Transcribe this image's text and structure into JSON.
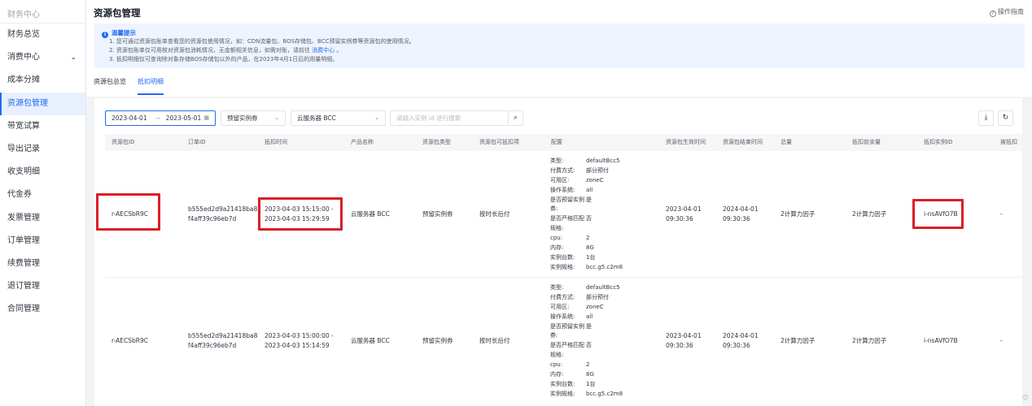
{
  "sidebar": {
    "top_label": "财务中心",
    "items": [
      {
        "label": "财务总览"
      },
      {
        "label": "消费中心",
        "expand": true
      },
      {
        "label": "成本分摊"
      },
      {
        "label": "资源包管理",
        "active": true
      },
      {
        "label": "带宽试算"
      },
      {
        "label": "导出记录"
      },
      {
        "label": "收支明细"
      },
      {
        "label": "代金券"
      },
      {
        "label": "发票管理"
      },
      {
        "label": "订单管理"
      },
      {
        "label": "续费管理"
      },
      {
        "label": "退订管理"
      },
      {
        "label": "合同管理"
      }
    ]
  },
  "header": {
    "title": "资源包管理",
    "guide_label": "操作指南"
  },
  "notice": {
    "title": "温馨提示",
    "lines": [
      "1. 您可通过资源包账单查看您的资源包使用情况，如：CDN流量包、BOS存储包、BCC预留实例券等资源包的使用情况。",
      "2. 资源包账单仅可用核对资源包消耗情况，无金额相关信息，如需对账，请前往",
      "3. 抵扣明细仅可查询除对象存储BOS存储包以外的产品，在2023年4月1日后的用量明细。"
    ],
    "line2_link": "消费中心",
    "line2_suffix": "。"
  },
  "tabs": [
    {
      "label": "资源包总览",
      "active": false
    },
    {
      "label": "抵扣明细",
      "active": true
    }
  ],
  "filters": {
    "date_start": "2023-04-01",
    "date_sep": "→",
    "date_end": "2023-05-01",
    "type_select": "预留实例券",
    "product_select": "云服务器 BCC",
    "search_placeholder": "请输入实例 id 进行搜索"
  },
  "table": {
    "columns": [
      "资源包ID",
      "订单ID",
      "抵扣时间",
      "产品名称",
      "资源包类型",
      "资源包可抵扣项",
      "配置",
      "资源包生效时间",
      "资源包结束时间",
      "总量",
      "抵扣前余量",
      "抵扣实例ID",
      "被抵扣"
    ],
    "config_keys": [
      "类型:",
      "付费方式:",
      "可用区:",
      "操作系统:",
      "是否预留实例券:",
      "是否严格匹配规格:",
      "cpu:",
      "内存:",
      "实例台数:",
      "实例规格:"
    ],
    "rows": [
      {
        "package_id": "r-AECSbR9C",
        "order_id_1": "b555ed2d9a21418ba8",
        "order_id_2": "f4aff39c96eb7d",
        "time_1": "2023-04-03 15:15:00 -",
        "time_2": "2023-04-03 15:29:59",
        "product": "云服务器 BCC",
        "pkg_type": "预留实例券",
        "deduct_item": "按时长后付",
        "config_values": [
          "defaultBcc5",
          "部分预付",
          "zoneC",
          "all",
          "是",
          "否",
          "2",
          "8G",
          "1台",
          "bcc.g5.c2m8"
        ],
        "start_1": "2023-04-01",
        "start_2": "09:30:36",
        "end_1": "2024-04-01",
        "end_2": "09:30:36",
        "total": "2计算力因子",
        "remain": "2计算力因子",
        "instance_id": "i-nsAVfO7B",
        "deducted": "-"
      },
      {
        "package_id": "r-AECSbR9C",
        "order_id_1": "b555ed2d9a21418ba8",
        "order_id_2": "f4aff39c96eb7d",
        "time_1": "2023-04-03 15:00:00 -",
        "time_2": "2023-04-03 15:14:59",
        "product": "云服务器 BCC",
        "pkg_type": "预留实例券",
        "deduct_item": "按时长后付",
        "config_values": [
          "defaultBcc5",
          "部分预付",
          "zoneC",
          "all",
          "是",
          "否",
          "2",
          "8G",
          "1台",
          "bcc.g5.c2m8"
        ],
        "start_1": "2023-04-01",
        "start_2": "09:30:36",
        "end_1": "2024-04-01",
        "end_2": "09:30:36",
        "total": "2计算力因子",
        "remain": "2计算力因子",
        "instance_id": "i-nsAVfO7B",
        "deducted": "-"
      }
    ]
  },
  "colors": {
    "accent": "#2468f2",
    "highlight": "#d8202a"
  }
}
